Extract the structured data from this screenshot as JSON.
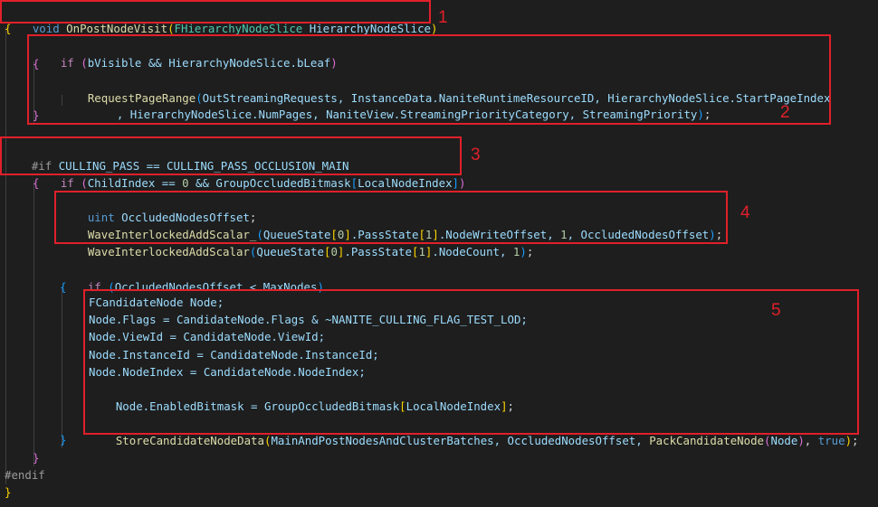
{
  "code": {
    "l1_void": "void",
    "l1_fn": "OnPostNodeVisit",
    "l1_open": "(",
    "l1_type": "FHierarchyNodeSlice",
    "l1_param": " HierarchyNodeSlice",
    "l1_close": ")",
    "l2": "{",
    "l3_if": "if",
    "l3_open": " (",
    "l3_body": "bVisible && HierarchyNodeSlice.bLeaf",
    "l3_close": ")",
    "l4": "{",
    "l5_fn": "RequestPageRange",
    "l5_open": "(",
    "l5_body": "OutStreamingRequests, InstanceData.NaniteRuntimeResourceID, HierarchyNodeSlice.StartPageIndex",
    "l6_body": ", HierarchyNodeSlice.NumPages, NaniteView.StreamingPriorityCategory, StreamingPriority",
    "l6_close": ")",
    "l6_semi": ";",
    "l7": "}",
    "l8_pre": "#if",
    "l8_body": " CULLING_PASS == CULLING_PASS_OCCLUSION_MAIN",
    "l9_if": "if",
    "l9_open": " (",
    "l9_a": "ChildIndex == ",
    "l9_num": "0",
    "l9_b": " && GroupOccludedBitmask",
    "l9_sqo": "[",
    "l9_idx": "LocalNodeIndex",
    "l9_sqc": "]",
    "l9_close": ")",
    "l10": "{",
    "l11_kw": "uint",
    "l11_var": " OccludedNodesOffset",
    "l11_semi": ";",
    "l12_fn": "WaveInterlockedAddScalar_",
    "l12_open": "(",
    "l12_a": "QueueState",
    "l12_s1o": "[",
    "l12_n0": "0",
    "l12_s1c": "]",
    "l12_b": ".PassState",
    "l12_s2o": "[",
    "l12_n1": "1",
    "l12_s2c": "]",
    "l12_c": ".NodeWriteOffset, ",
    "l12_n2": "1",
    "l12_d": ", OccludedNodesOffset",
    "l12_close": ")",
    "l12_semi": ";",
    "l13_fn": "WaveInterlockedAddScalar",
    "l13_open": "(",
    "l13_a": "QueueState",
    "l13_s1o": "[",
    "l13_n0": "0",
    "l13_s1c": "]",
    "l13_b": ".PassState",
    "l13_s2o": "[",
    "l13_n1": "1",
    "l13_s2c": "]",
    "l13_c": ".NodeCount, ",
    "l13_n2": "1",
    "l13_close": ")",
    "l13_semi": ";",
    "l15_if": "if",
    "l15_open": " (",
    "l15_body": "OccludedNodesOffset < MaxNodes",
    "l15_close": ")",
    "l16": "{",
    "l17": "FCandidateNode Node;",
    "l18": "Node.Flags = CandidateNode.Flags & ~NANITE_CULLING_FLAG_TEST_LOD;",
    "l19": "Node.ViewId = CandidateNode.ViewId;",
    "l20": "Node.InstanceId = CandidateNode.InstanceId;",
    "l21": "Node.NodeIndex = CandidateNode.NodeIndex;",
    "l22_a": "Node.EnabledBitmask = GroupOccludedBitmask",
    "l22_sqo": "[",
    "l22_idx": "LocalNodeIndex",
    "l22_sqc": "]",
    "l22_semi": ";",
    "l24_fn": "StoreCandidateNodeData",
    "l24_open": "(",
    "l24_a": "MainAndPostNodesAndClusterBatches, OccludedNodesOffset, ",
    "l24_fn2": "PackCandidateNode",
    "l24_po": "(",
    "l24_b": "Node",
    "l24_pc": ")",
    "l24_c": ", ",
    "l24_true": "true",
    "l24_close": ")",
    "l24_semi": ";",
    "l25": "}",
    "l26": "}",
    "l27": "#endif",
    "l28": "}"
  },
  "labels": {
    "n1": "1",
    "n2": "2",
    "n3": "3",
    "n4": "4",
    "n5": "5"
  },
  "colors": {
    "highlight": "#e0202a",
    "background": "#1e1e1e"
  }
}
